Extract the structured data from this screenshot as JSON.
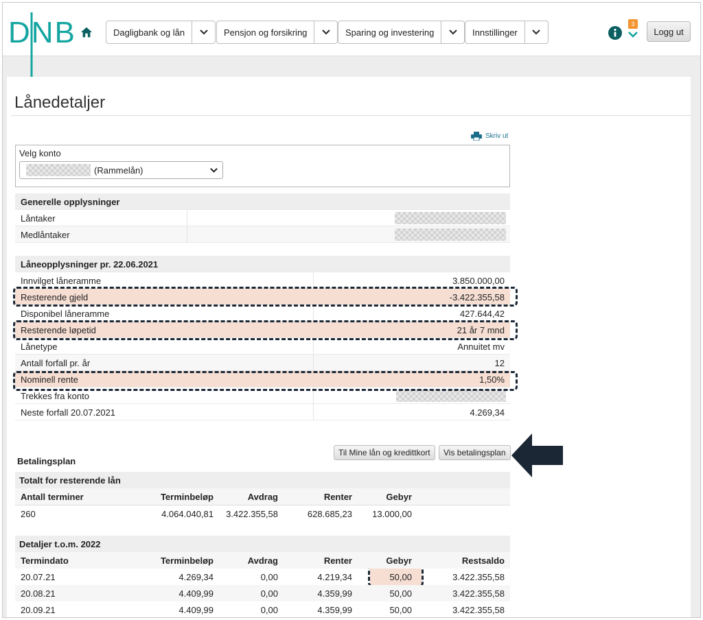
{
  "header": {
    "logo_text": "DNB",
    "nav": [
      {
        "label": "Dagligbank og lån"
      },
      {
        "label": "Pensjon og forsikring"
      },
      {
        "label": "Sparing og investering"
      },
      {
        "label": "Innstillinger"
      }
    ],
    "notification_count": "3",
    "logout_label": "Logg ut",
    "colors": {
      "brand": "#14a5a0",
      "badge": "#f4932f",
      "info": "#0b5f61"
    }
  },
  "page": {
    "title": "Lånedetaljer",
    "print_label": "Skriv ut",
    "account_select": {
      "label": "Velg konto",
      "value": "(Rammelån)"
    }
  },
  "general": {
    "heading": "Generelle opplysninger",
    "rows": [
      {
        "label": "Låntaker"
      },
      {
        "label": "Medlåntaker"
      }
    ]
  },
  "loan": {
    "heading": "Låneopplysninger pr. 22.06.2021",
    "rows": [
      {
        "label": "Innvilget låneramme",
        "value": "3.850.000,00"
      },
      {
        "label": "Resterende gjeld",
        "value": "-3.422.355,58"
      },
      {
        "label": "Disponibel låneramme",
        "value": "427.644,42"
      },
      {
        "label": "Resterende løpetid",
        "value": "21 år 7 mnd"
      },
      {
        "label": "Lånetype",
        "value": "Annuitet mv"
      },
      {
        "label": "Antall forfall pr. år",
        "value": "12"
      },
      {
        "label": "Nominell rente",
        "value": "1,50%"
      },
      {
        "label": "Trekkes fra konto",
        "value": ""
      },
      {
        "label": "Neste forfall 20.07.2021",
        "value": "4.269,34"
      }
    ]
  },
  "buttons": {
    "my_loans": "Til Mine lån og kredittkort",
    "show_plan": "Vis betalingsplan"
  },
  "plan": {
    "title": "Betalingsplan",
    "totals": {
      "heading": "Totalt for resterende lån",
      "headers": [
        "Antall terminer",
        "Terminbeløp",
        "Avdrag",
        "Renter",
        "Gebyr"
      ],
      "row": [
        "260",
        "4.064.040,81",
        "3.422.355,58",
        "628.685,23",
        "13.000,00"
      ]
    },
    "details": {
      "heading": "Detaljer t.o.m. 2022",
      "headers": [
        "Termindato",
        "Terminbeløp",
        "Avdrag",
        "Renter",
        "Gebyr",
        "Restsaldo"
      ],
      "rows": [
        [
          "20.07.21",
          "4.269,34",
          "0,00",
          "4.219,34",
          "50,00",
          "3.422.355,58"
        ],
        [
          "20.08.21",
          "4.409,99",
          "0,00",
          "4.359,99",
          "50,00",
          "3.422.355,58"
        ],
        [
          "20.09.21",
          "4.409,99",
          "0,00",
          "4.359,99",
          "50,00",
          "3.422.355,58"
        ]
      ]
    }
  }
}
